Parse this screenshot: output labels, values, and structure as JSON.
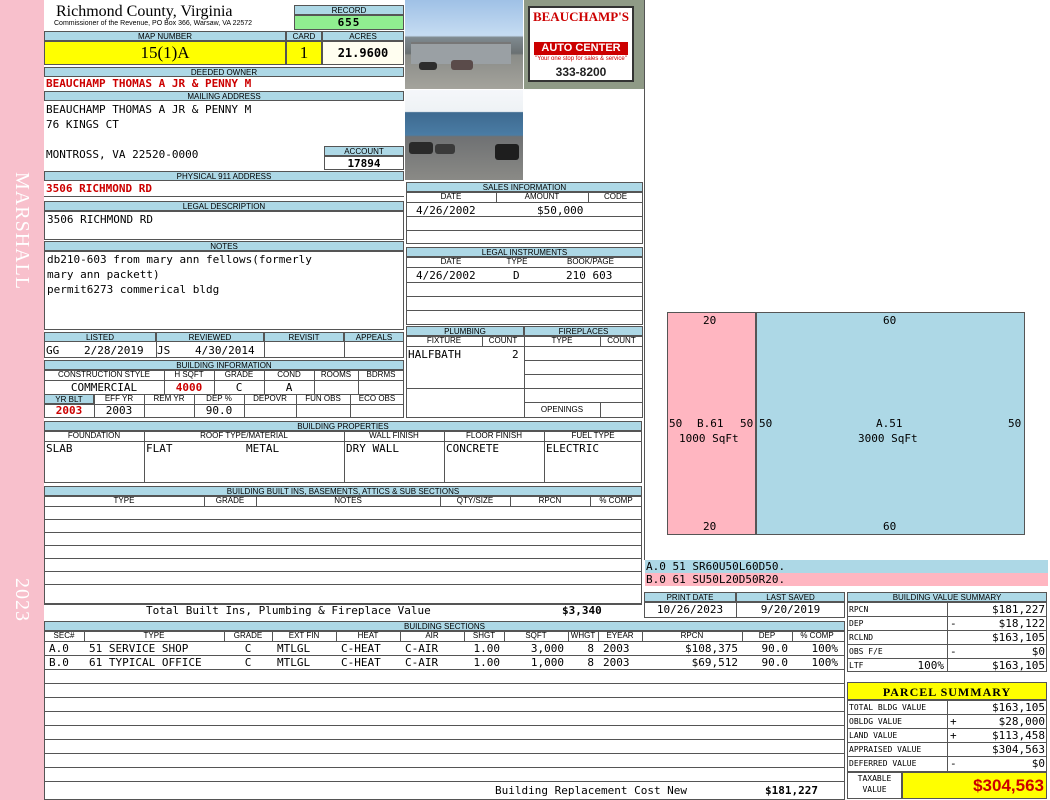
{
  "side": {
    "district": "MARSHALL",
    "year": "2023"
  },
  "header": {
    "county": "Richmond County, Virginia",
    "commissioner": "Commissioner of the Revenue, PO Box 366, Warsaw, VA 22572",
    "record_label": "RECORD",
    "record": "655",
    "map_number_label": "MAP NUMBER",
    "map_number": "15(1)A",
    "card_label": "CARD",
    "card": "1",
    "acres_label": "ACRES",
    "acres": "21.9600"
  },
  "owner": {
    "deeded_owner_label": "DEEDED OWNER",
    "deeded_owner": "BEAUCHAMP THOMAS A JR & PENNY M",
    "mailing_label": "MAILING ADDRESS",
    "mailing_line1": "BEAUCHAMP THOMAS A JR & PENNY M",
    "mailing_line2": "76 KINGS CT",
    "mailing_line3": "MONTROSS, VA 22520-0000",
    "account_label": "ACCOUNT",
    "account": "17894",
    "physical_label": "PHYSICAL 911 ADDRESS",
    "physical": "3506 RICHMOND RD",
    "legal_label": "LEGAL DESCRIPTION",
    "legal": "3506 RICHMOND RD",
    "notes_label": "NOTES",
    "notes_line1": "db210-603 from mary ann fellows(formerly",
    "notes_line2": "mary ann packett)",
    "notes_line3": "permit6273 commerical bldg"
  },
  "photo": {
    "sign_line1": "BEAUCHAMP'S",
    "sign_line2": "AUTO CENTER",
    "sign_tagline": "\"Your one stop for sales & service\"",
    "sign_phone": "333-8200"
  },
  "sales": {
    "title": "SALES INFORMATION",
    "h_date": "DATE",
    "h_amount": "AMOUNT",
    "h_code": "CODE",
    "date": "4/26/2002",
    "amount": "$50,000"
  },
  "legal_inst": {
    "title": "LEGAL INSTRUMENTS",
    "h_date": "DATE",
    "h_type": "TYPE",
    "h_book": "BOOK/PAGE",
    "date": "4/26/2002",
    "type": "D",
    "book": "210 603"
  },
  "listed": {
    "h_listed": "LISTED",
    "h_reviewed": "REVIEWED",
    "h_revisit": "REVISIT",
    "h_appeals": "APPEALS",
    "listed_by": "GG",
    "listed_date": "2/28/2019",
    "reviewed_by": "JS",
    "reviewed_date": "4/30/2014"
  },
  "plumbing": {
    "title": "PLUMBING",
    "h_fixture": "FIXTURE",
    "h_count": "COUNT",
    "fixture": "HALFBATH",
    "count": "2"
  },
  "fireplaces": {
    "title": "FIREPLACES",
    "h_type": "TYPE",
    "h_count": "COUNT",
    "openings": "OPENINGS"
  },
  "building_info": {
    "title": "BUILDING INFORMATION",
    "h_style": "CONSTRUCTION STYLE",
    "h_hsqft": "H SQFT",
    "h_grade": "GRADE",
    "h_cond": "COND",
    "h_rooms": "ROOMS",
    "h_bdrms": "BDRMS",
    "style": "COMMERCIAL",
    "hsqft": "4000",
    "grade": "C",
    "cond": "A",
    "h_yrblt": "YR BLT",
    "h_effyr": "EFF YR",
    "h_remyr": "REM YR",
    "h_dep": "DEP %",
    "h_depovr": "DEPOVR",
    "h_funobs": "FUN OBS",
    "h_ecoobs": "ECO OBS",
    "yrblt": "2003",
    "effyr": "2003",
    "dep": "90.0"
  },
  "properties": {
    "title": "BUILDING PROPERTIES",
    "h_foundation": "FOUNDATION",
    "h_roof": "ROOF TYPE/MATERIAL",
    "h_wall": "WALL FINISH",
    "h_floor": "FLOOR FINISH",
    "h_fuel": "FUEL TYPE",
    "foundation": "SLAB",
    "roof_type": "FLAT",
    "roof_mat": "METAL",
    "wall": "DRY WALL",
    "floor": "CONCRETE",
    "fuel": "ELECTRIC"
  },
  "builtins": {
    "title": "BUILDING BUILT INS, BASEMENTS, ATTICS & SUB SECTIONS",
    "h_type": "TYPE",
    "h_grade": "GRADE",
    "h_notes": "NOTES",
    "h_qty": "QTY/SIZE",
    "h_rpcn": "RPCN",
    "h_comp": "% COMP",
    "total_label": "Total Built Ins, Plumbing & Fireplace Value",
    "total": "$3,340"
  },
  "sketch": {
    "b_top": "20",
    "b_bottom": "20",
    "b_left": "50",
    "b_right": "50",
    "b_label": "B.61",
    "b_area": "1000 SqFt",
    "a_top": "60",
    "a_bottom": "60",
    "a_left": "50",
    "a_right": "50",
    "a_label": "A.51",
    "a_area": "3000 SqFt",
    "code_a": "A.0  51   SR60U50L60D50.",
    "code_b": "B.0  61   SU50L20D50R20."
  },
  "print": {
    "h_print": "PRINT DATE",
    "h_saved": "LAST SAVED",
    "print_date": "10/26/2023",
    "saved_date": "9/20/2019"
  },
  "value_summary": {
    "title": "BUILDING VALUE SUMMARY",
    "rpcn_label": "RPCN",
    "rpcn": "$181,227",
    "dep_label": "DEP",
    "dep_sign": "-",
    "dep": "$18,122",
    "rclnd_label": "RCLND",
    "rclnd": "$163,105",
    "obs_label": "OBS F/E",
    "obs_sign": "-",
    "obs": "$0",
    "ltf_label": "LTF",
    "ltf_pct": "100%",
    "ltf": "$163,105"
  },
  "sections": {
    "title": "BUILDING SECTIONS",
    "headers": [
      "SEC#",
      "TYPE",
      "GRADE",
      "EXT FIN",
      "HEAT",
      "AIR",
      "SHGT",
      "SQFT",
      "WHGT",
      "EYEAR",
      "RPCN",
      "DEP",
      "% COMP"
    ],
    "rows": [
      [
        "A.0",
        "51 SERVICE SHOP",
        "C",
        "MTLGL",
        "C-HEAT",
        "C-AIR",
        "1.00",
        "3,000",
        "8",
        "2003",
        "$108,375",
        "90.0",
        "100%"
      ],
      [
        "B.0",
        "61 TYPICAL OFFICE",
        "C",
        "MTLGL",
        "C-HEAT",
        "C-AIR",
        "1.00",
        "1,000",
        "8",
        "2003",
        "$69,512",
        "90.0",
        "100%"
      ]
    ],
    "replacement_label": "Building Replacement Cost New",
    "replacement": "$181,227"
  },
  "parcel": {
    "title": "PARCEL SUMMARY",
    "total_bldg_label": "TOTAL BLDG VALUE",
    "total_bldg": "$163,105",
    "obldg_label": "OBLDG VALUE",
    "obldg_sign": "+",
    "obldg": "$28,000",
    "land_label": "LAND VALUE",
    "land_sign": "+",
    "land": "$113,458",
    "appraised_label": "APPRAISED VALUE",
    "appraised": "$304,563",
    "deferred_label": "DEFERRED VALUE",
    "deferred_sign": "-",
    "deferred": "$0",
    "taxable_label1": "TAXABLE",
    "taxable_label2": "VALUE",
    "taxable": "$304,563"
  },
  "colors": {
    "header_blue": "#add8e6",
    "highlight_yellow": "#ffff00",
    "record_green": "#90ee90",
    "side_pink": "#f8c0cc",
    "red_text": "#cc0000"
  }
}
